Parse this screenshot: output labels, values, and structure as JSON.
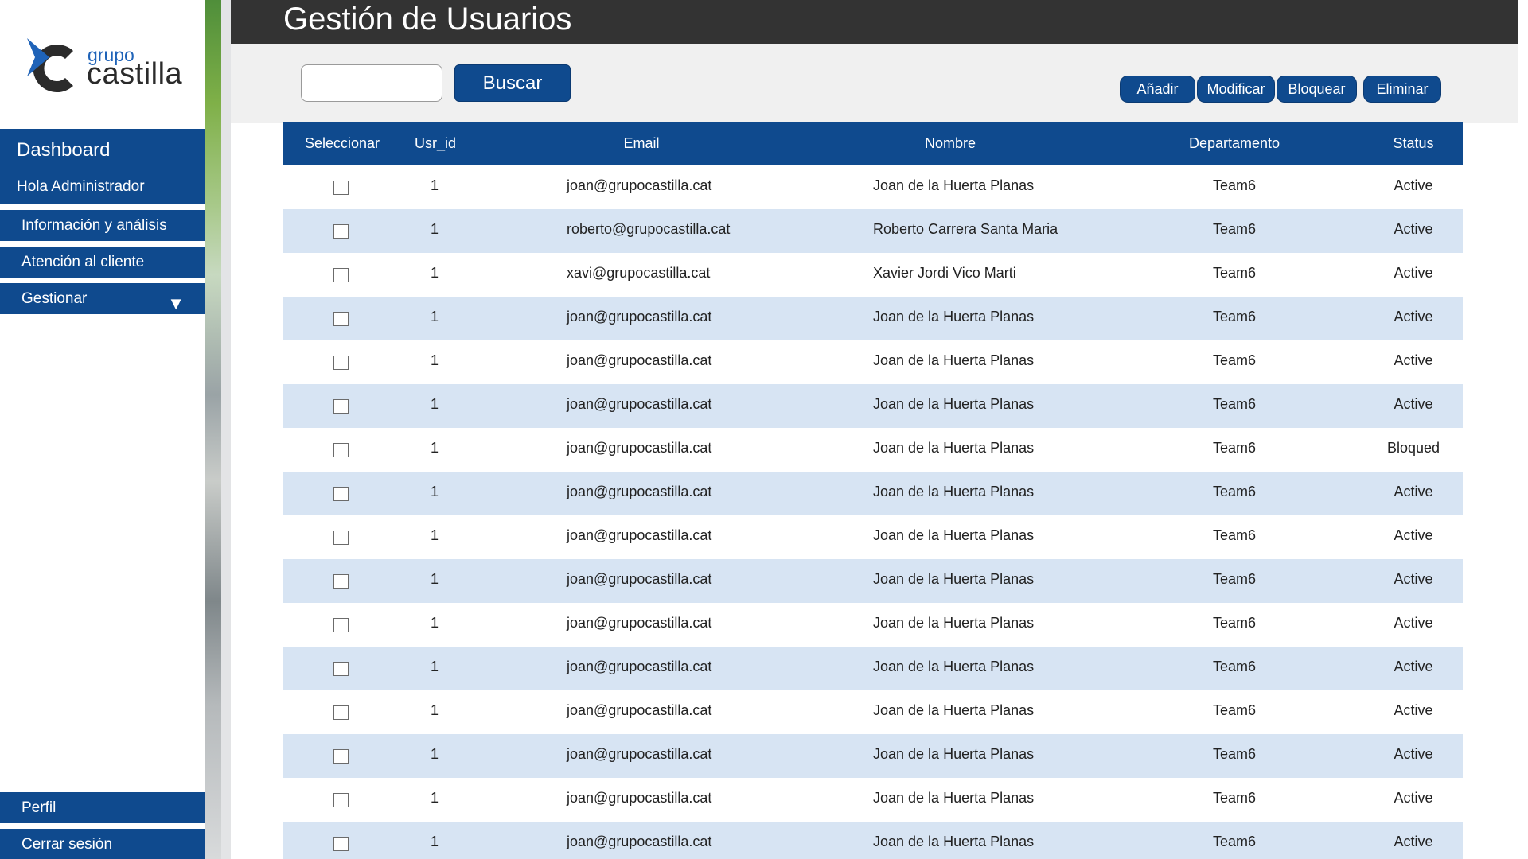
{
  "sidebar": {
    "logo_small": "grupo",
    "logo_big": "castilla",
    "title": "Dashboard",
    "greeting": "Hola Administrador",
    "items": [
      {
        "label": "Información y análisis"
      },
      {
        "label": "Atención al cliente"
      },
      {
        "label": "Gestionar",
        "icon": "triangle-down-icon"
      }
    ],
    "bottom_items": [
      {
        "label": "Perfil"
      },
      {
        "label": "Cerrar sesión"
      }
    ]
  },
  "header": {
    "title": "Gestión de Usuarios"
  },
  "toolbar": {
    "search_placeholder": "",
    "search_label": "Buscar",
    "add_label": "Añadir",
    "modify_label": "Modificar",
    "block_label": "Bloquear",
    "delete_label": "Eliminar"
  },
  "table": {
    "columns": [
      "Seleccionar",
      "Usr_id",
      "Email",
      "Nombre",
      "Departamento",
      "Status"
    ],
    "rows": [
      {
        "id": "1",
        "email": "joan@grupocastilla.cat",
        "name": "Joan de la Huerta Planas",
        "dept": "Team6",
        "status": "Active"
      },
      {
        "id": "1",
        "email": "roberto@grupocastilla.cat",
        "name": "Roberto Carrera Santa Maria",
        "dept": "Team6",
        "status": "Active"
      },
      {
        "id": "1",
        "email": "xavi@grupocastilla.cat",
        "name": "Xavier Jordi Vico Marti",
        "dept": "Team6",
        "status": "Active"
      },
      {
        "id": "1",
        "email": "joan@grupocastilla.cat",
        "name": "Joan de la Huerta Planas",
        "dept": "Team6",
        "status": "Active"
      },
      {
        "id": "1",
        "email": "joan@grupocastilla.cat",
        "name": "Joan de la Huerta Planas",
        "dept": "Team6",
        "status": "Active"
      },
      {
        "id": "1",
        "email": "joan@grupocastilla.cat",
        "name": "Joan de la Huerta Planas",
        "dept": "Team6",
        "status": "Active"
      },
      {
        "id": "1",
        "email": "joan@grupocastilla.cat",
        "name": "Joan de la Huerta Planas",
        "dept": "Team6",
        "status": "Bloqued"
      },
      {
        "id": "1",
        "email": "joan@grupocastilla.cat",
        "name": "Joan de la Huerta Planas",
        "dept": "Team6",
        "status": "Active"
      },
      {
        "id": "1",
        "email": "joan@grupocastilla.cat",
        "name": "Joan de la Huerta Planas",
        "dept": "Team6",
        "status": "Active"
      },
      {
        "id": "1",
        "email": "joan@grupocastilla.cat",
        "name": "Joan de la Huerta Planas",
        "dept": "Team6",
        "status": "Active"
      },
      {
        "id": "1",
        "email": "joan@grupocastilla.cat",
        "name": "Joan de la Huerta Planas",
        "dept": "Team6",
        "status": "Active"
      },
      {
        "id": "1",
        "email": "joan@grupocastilla.cat",
        "name": "Joan de la Huerta Planas",
        "dept": "Team6",
        "status": "Active"
      },
      {
        "id": "1",
        "email": "joan@grupocastilla.cat",
        "name": "Joan de la Huerta Planas",
        "dept": "Team6",
        "status": "Active"
      },
      {
        "id": "1",
        "email": "joan@grupocastilla.cat",
        "name": "Joan de la Huerta Planas",
        "dept": "Team6",
        "status": "Active"
      },
      {
        "id": "1",
        "email": "joan@grupocastilla.cat",
        "name": "Joan de la Huerta Planas",
        "dept": "Team6",
        "status": "Active"
      },
      {
        "id": "1",
        "email": "joan@grupocastilla.cat",
        "name": "Joan de la Huerta Planas",
        "dept": "Team6",
        "status": "Active"
      }
    ]
  },
  "colors": {
    "primary": "#0f4a8e",
    "header_bg": "#333333",
    "row_alt": "#d7e4f3",
    "toolbar_bg": "#f0f0f0"
  }
}
